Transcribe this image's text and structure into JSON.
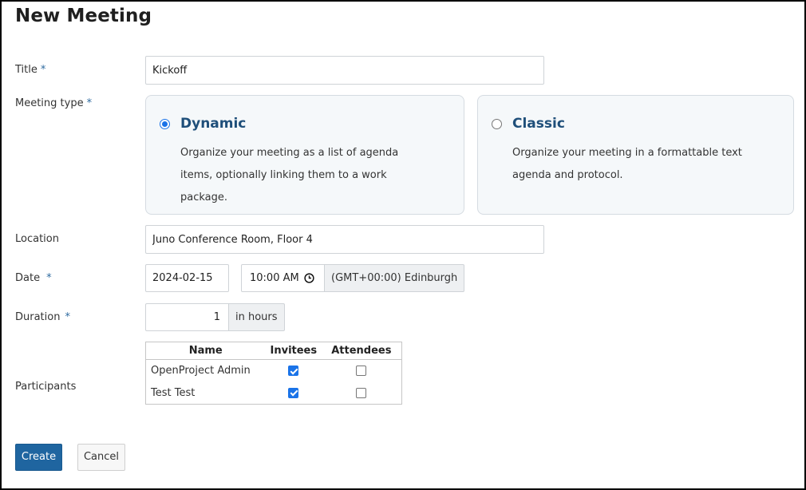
{
  "page": {
    "title": "New Meeting"
  },
  "form": {
    "title": {
      "label": "Title",
      "required_mark": "*",
      "value": "Kickoff"
    },
    "meeting_type": {
      "label": "Meeting type",
      "required_mark": "*",
      "options": [
        {
          "name": "Dynamic",
          "description": "Organize your meeting as a list of agenda items, optionally linking them to a work package.",
          "selected": true
        },
        {
          "name": "Classic",
          "description": "Organize your meeting in a formattable text agenda and protocol.",
          "selected": false
        }
      ]
    },
    "location": {
      "label": "Location",
      "value": "Juno Conference Room, Floor 4"
    },
    "date": {
      "label": "Date",
      "required_mark": "*",
      "date_value": "2024-02-15",
      "time_value": "10:00 AM",
      "timezone": "(GMT+00:00) Edinburgh"
    },
    "duration": {
      "label": "Duration",
      "required_mark": "*",
      "value": "1",
      "unit": "in hours"
    },
    "participants": {
      "label": "Participants",
      "columns": [
        "Name",
        "Invitees",
        "Attendees"
      ],
      "rows": [
        {
          "name": "OpenProject Admin",
          "invitee": true,
          "attendee": false
        },
        {
          "name": "Test Test",
          "invitee": true,
          "attendee": false
        }
      ]
    }
  },
  "actions": {
    "create_label": "Create",
    "cancel_label": "Cancel"
  },
  "colors": {
    "primary_button": "#1f65a0",
    "card_title": "#1f4f7a",
    "radio_checked": "#1a73e8"
  }
}
